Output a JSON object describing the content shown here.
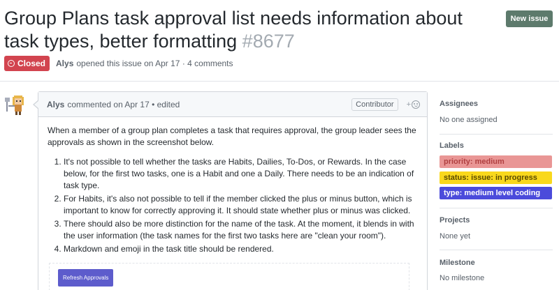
{
  "issue": {
    "title": "Group Plans task approval list needs information about task types, better formatting",
    "number": "#8677",
    "new_issue_label": "New issue",
    "state": "Closed",
    "author": "Alys",
    "meta_text": "opened this issue on Apr 17 · 4 comments"
  },
  "comment": {
    "author": "Alys",
    "meta": "commented on Apr 17 • edited",
    "role": "Contributor",
    "reaction_plus": "+",
    "intro": "When a member of a group plan completes a task that requires approval, the group leader sees the approvals as shown in the screenshot below.",
    "items": [
      "It's not possible to tell whether the tasks are Habits, Dailies, To-Dos, or Rewards. In the case below, for the first two tasks, one is a Habit and one a Daily. There needs to be an indication of task type.",
      "For Habits, it's also not possible to tell if the member clicked the plus or minus button, which is important to know for correctly approving it. It should state whether plus or minus was clicked.",
      "There should also be more distinction for the name of the task. At the moment, it blends in with the user information (the task names for the first two tasks here are \"clean your room\").",
      "Markdown and emoji in the task title should be rendered."
    ],
    "screenshot_button": "Refresh Approvals"
  },
  "sidebar": {
    "assignees_heading": "Assignees",
    "assignees_value": "No one assigned",
    "labels_heading": "Labels",
    "labels": [
      {
        "text": "priority: medium",
        "bg": "#e99695",
        "fg": "#b04040"
      },
      {
        "text": "status: issue: in progress",
        "bg": "#f9d81c",
        "fg": "#5a4a00"
      },
      {
        "text": "type: medium level coding",
        "bg": "#4b4bdb",
        "fg": "#ffffff"
      }
    ],
    "projects_heading": "Projects",
    "projects_value": "None yet",
    "milestone_heading": "Milestone",
    "milestone_value": "No milestone"
  }
}
